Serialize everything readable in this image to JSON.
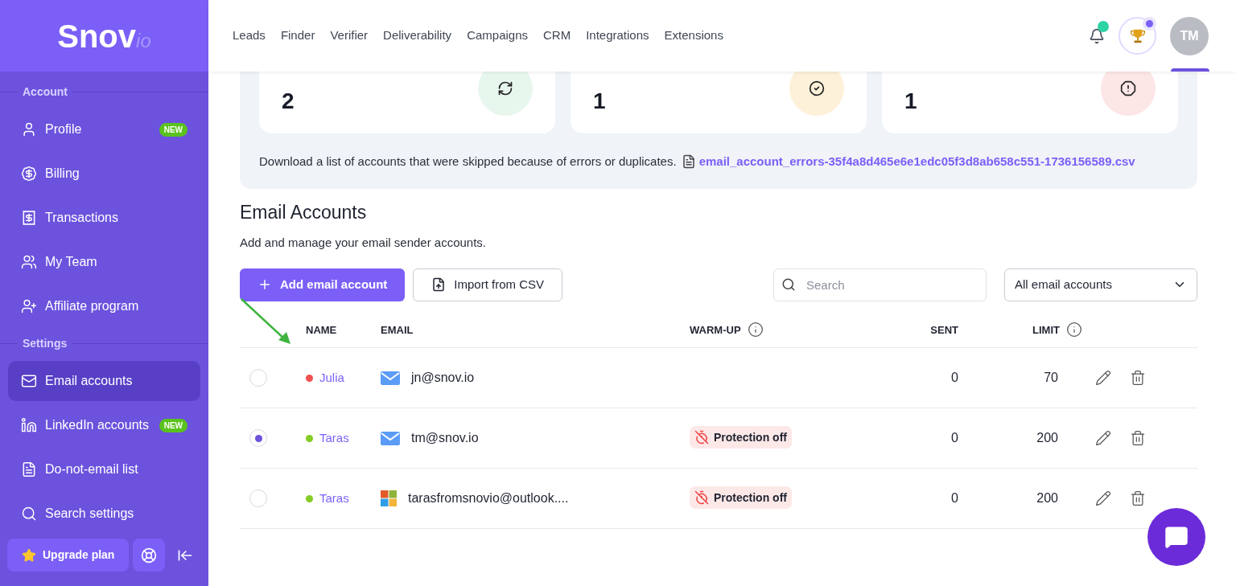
{
  "logo": {
    "main": "Snov",
    "suffix": "io"
  },
  "nav": [
    "Leads",
    "Finder",
    "Verifier",
    "Deliverability",
    "Campaigns",
    "CRM",
    "Integrations",
    "Extensions"
  ],
  "header": {
    "notification_dot": true,
    "avatar": "TM"
  },
  "sidebar": {
    "sections": [
      {
        "title": "Account",
        "items": [
          {
            "label": "Profile",
            "badge": "NEW",
            "selected": false
          },
          {
            "label": "Billing",
            "selected": false
          },
          {
            "label": "Transactions",
            "selected": false
          },
          {
            "label": "My Team",
            "selected": false
          },
          {
            "label": "Affiliate program",
            "selected": false
          }
        ]
      },
      {
        "title": "Settings",
        "items": [
          {
            "label": "Email accounts",
            "selected": true
          },
          {
            "label": "LinkedIn accounts",
            "badge": "NEW",
            "selected": false
          },
          {
            "label": "Do-not-email list",
            "selected": false
          },
          {
            "label": "Search settings",
            "selected": false
          }
        ]
      }
    ],
    "upgrade": "Upgrade plan"
  },
  "stats": [
    {
      "kind": "processed",
      "value": "2"
    },
    {
      "kind": "added",
      "value": "1"
    },
    {
      "kind": "skipped",
      "value": "1"
    }
  ],
  "download": {
    "text": "Download a list of accounts that were skipped because of errors or duplicates.",
    "link": "email_account_errors-35f4a8d465e6e1edc05f3d8ab658c551-1736156589.csv"
  },
  "title": "Email Accounts",
  "subtitle": "Add and manage your email sender accounts.",
  "actions": {
    "add": "Add email account",
    "import": "Import from CSV"
  },
  "search": {
    "placeholder": "Search"
  },
  "filter": {
    "value": "All email accounts"
  },
  "columns": [
    {
      "label": "NAME",
      "info": false
    },
    {
      "label": "EMAIL",
      "info": false
    },
    {
      "label": "WARM-UP",
      "info": true
    },
    {
      "label": "SENT",
      "info": false
    },
    {
      "label": "LIMIT",
      "info": true
    }
  ],
  "rows": [
    {
      "selected": false,
      "name": "Julia",
      "color": "#f0524f",
      "kind": "mail",
      "email": "jn@snov.io",
      "warmup": null,
      "sent": "0",
      "limit": "70"
    },
    {
      "selected": true,
      "name": "Taras",
      "color": "#84cc22",
      "kind": "mail",
      "email": "tm@snov.io",
      "warmup": "Protection off",
      "sent": "0",
      "limit": "200"
    },
    {
      "selected": false,
      "name": "Taras",
      "color": "#84cc22",
      "kind": "microsoft",
      "email": "tarasfromsnovio@outlook....",
      "warmup": "Protection off",
      "sent": "0",
      "limit": "200"
    }
  ]
}
